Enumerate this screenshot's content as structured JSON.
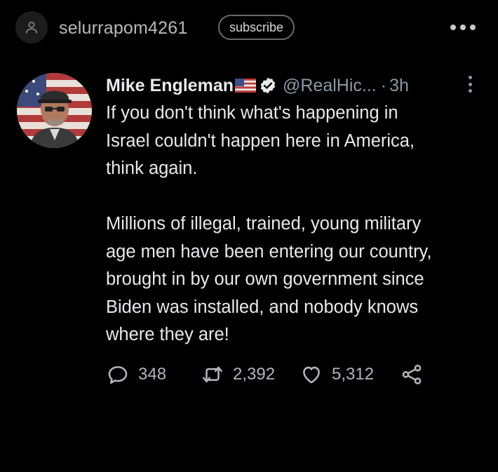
{
  "topbar": {
    "username": "selurrapom4261",
    "subscribe_label": "subscribe",
    "user_icon": "person-icon",
    "more_icon": "more-horizontal-icon"
  },
  "tweet": {
    "author": {
      "display_name": "Mike Engleman",
      "handle": "@RealHic...",
      "time": "3h",
      "flag_icon": "us-flag-icon",
      "verified_icon": "verified-badge-icon"
    },
    "paragraphs": [
      [
        "If you don't think what's happening in",
        "Israel couldn't happen here in America,",
        "think again."
      ],
      [
        "Millions of illegal, trained, young military",
        "age men have been entering our country,",
        "brought in by our own government since",
        "Biden was installed, and nobody knows",
        "where they are!"
      ]
    ],
    "stats": {
      "replies": "348",
      "retweets": "2,392",
      "likes": "5,312"
    }
  },
  "colors": {
    "background": "#000000",
    "text": "#e7e9ea",
    "muted": "#8b98a5"
  }
}
